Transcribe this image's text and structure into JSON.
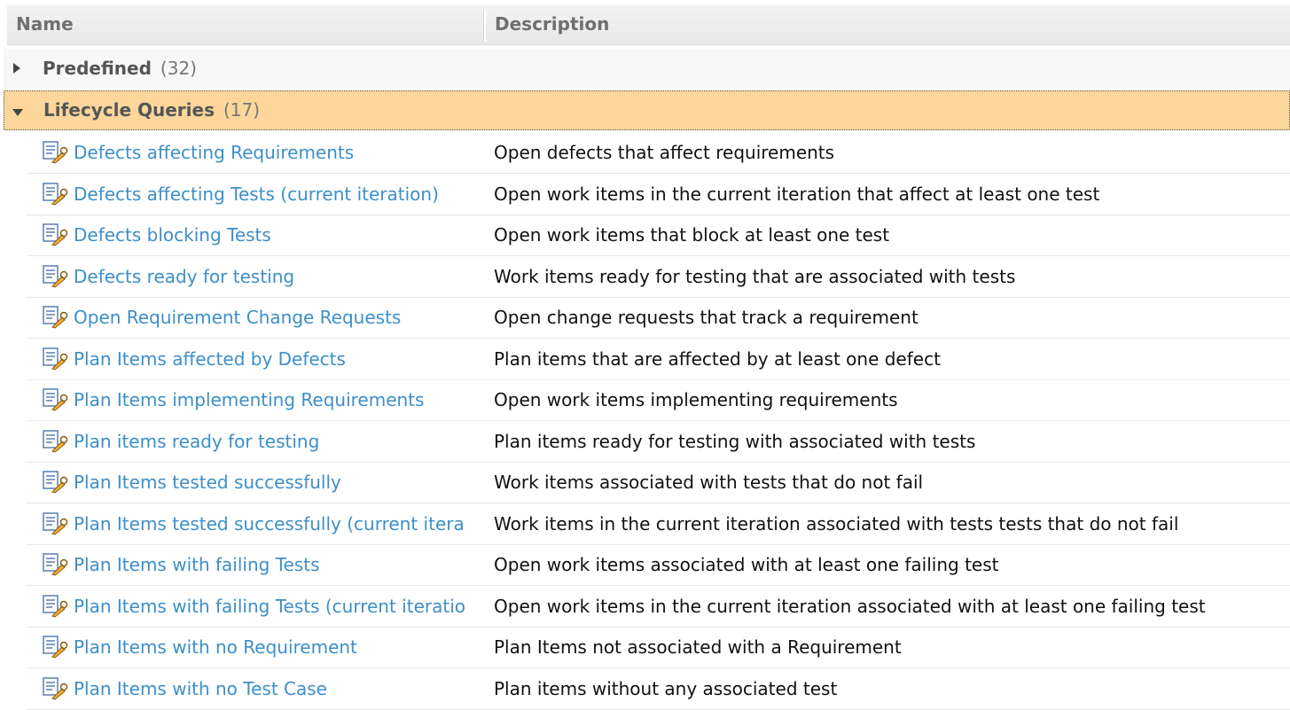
{
  "header": {
    "name_label": "Name",
    "description_label": "Description"
  },
  "groups": [
    {
      "label": "Predefined",
      "count": "(32)",
      "expanded": false
    },
    {
      "label": "Lifecycle Queries",
      "count": "(17)",
      "expanded": true
    }
  ],
  "icons": {
    "query": "query-icon",
    "collapsed": "triangle-right-icon",
    "expanded": "triangle-down-icon"
  },
  "colors": {
    "link": "#3d8fc8",
    "selected_group": "#fcd69a",
    "header_text": "#6f6f6f"
  },
  "rows": [
    {
      "name": "Defects affecting Requirements",
      "description": "Open defects that affect requirements"
    },
    {
      "name": "Defects affecting Tests (current iteration)",
      "description": "Open work items in the current iteration that affect at least one test"
    },
    {
      "name": "Defects blocking Tests",
      "description": "Open work items that block at least one test"
    },
    {
      "name": "Defects ready for testing",
      "description": "Work items ready for testing that are associated with tests"
    },
    {
      "name": "Open Requirement Change Requests",
      "description": "Open change requests that track a requirement"
    },
    {
      "name": "Plan Items affected by Defects",
      "description": "Plan items that are affected by at least one defect"
    },
    {
      "name": "Plan Items implementing Requirements",
      "description": "Open work items implementing requirements"
    },
    {
      "name": "Plan items ready for testing",
      "description": "Plan items ready for testing with associated with tests"
    },
    {
      "name": "Plan Items tested successfully",
      "description": "Work items associated with tests that do not fail"
    },
    {
      "name": "Plan Items tested successfully (current itera",
      "description": "Work items in the current iteration associated with tests tests that do not fail"
    },
    {
      "name": "Plan Items with failing Tests",
      "description": "Open work items associated with at least one failing test"
    },
    {
      "name": "Plan Items with failing Tests (current iteratio",
      "description": "Open work items in the current iteration associated with at least one failing test"
    },
    {
      "name": "Plan Items with no Requirement",
      "description": "Plan Items not associated with a Requirement"
    },
    {
      "name": "Plan Items with no Test Case",
      "description": "Plan items without any associated test"
    }
  ]
}
